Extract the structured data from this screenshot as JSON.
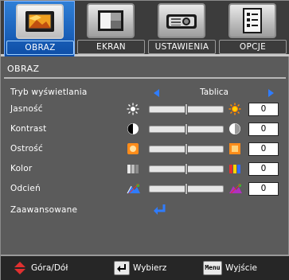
{
  "tabs": [
    {
      "label": "OBRAZ",
      "icon": "picture-icon",
      "active": true
    },
    {
      "label": "EKRAN",
      "icon": "screen-icon",
      "active": false
    },
    {
      "label": "USTAWIENIA",
      "icon": "projector-icon",
      "active": false
    },
    {
      "label": "OPCJE",
      "icon": "options-icon",
      "active": false
    }
  ],
  "section_title": "OBRAZ",
  "display_mode": {
    "label": "Tryb wyświetlania",
    "value": "Tablica"
  },
  "rows": [
    {
      "label": "Jasność",
      "value": "0",
      "left_icon": "brightness-low-icon",
      "right_icon": "brightness-high-icon",
      "level": 0.5
    },
    {
      "label": "Kontrast",
      "value": "0",
      "left_icon": "contrast-low-icon",
      "right_icon": "contrast-high-icon",
      "level": 0.5
    },
    {
      "label": "Ostrość",
      "value": "0",
      "left_icon": "sharpness-low-icon",
      "right_icon": "sharpness-high-icon",
      "level": 0.5
    },
    {
      "label": "Kolor",
      "value": "0",
      "left_icon": "color-low-icon",
      "right_icon": "color-high-icon",
      "level": 0.5
    },
    {
      "label": "Odcień",
      "value": "0",
      "left_icon": "tint-low-icon",
      "right_icon": "tint-high-icon",
      "level": 0.5
    }
  ],
  "advanced": {
    "label": "Zaawansowane",
    "icon": "enter-icon"
  },
  "footer": {
    "nav_label": "Góra/Dół",
    "select_label": "Wybierz",
    "menu_key": "Menu",
    "exit_label": "Wyjście"
  },
  "colors": {
    "accent_blue": "#2f7cff",
    "tab_active": "#1f66c8",
    "background": "#5b5b5b"
  }
}
